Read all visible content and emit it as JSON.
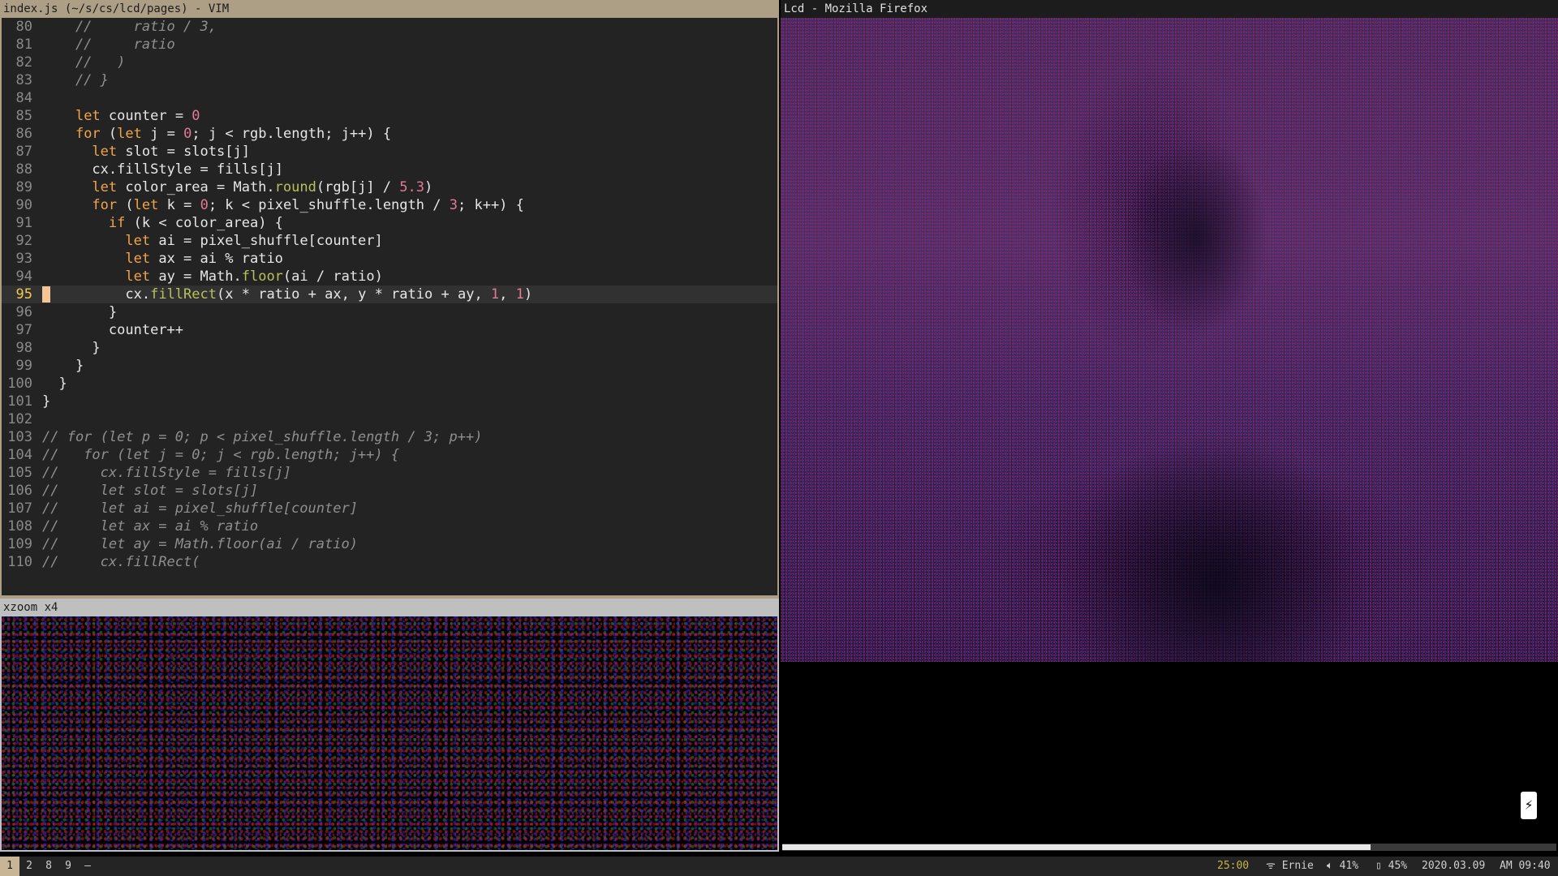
{
  "vim": {
    "title": "index.js (~/s/cs/lcd/pages) - VIM",
    "lines": [
      {
        "n": "80",
        "code": "    //     ratio / 3,",
        "kind": "comment"
      },
      {
        "n": "81",
        "code": "    //     ratio",
        "kind": "comment"
      },
      {
        "n": "82",
        "code": "    //   )",
        "kind": "comment"
      },
      {
        "n": "83",
        "code": "    // }",
        "kind": "comment"
      },
      {
        "n": "84",
        "code": "",
        "kind": "code"
      },
      {
        "n": "85",
        "code": "    let counter = 0",
        "kind": "code"
      },
      {
        "n": "86",
        "code": "    for (let j = 0; j < rgb.length; j++) {",
        "kind": "code"
      },
      {
        "n": "87",
        "code": "      let slot = slots[j]",
        "kind": "code"
      },
      {
        "n": "88",
        "code": "      cx.fillStyle = fills[j]",
        "kind": "code"
      },
      {
        "n": "89",
        "code": "      let color_area = Math.round(rgb[j] / 5.3)",
        "kind": "code"
      },
      {
        "n": "90",
        "code": "      for (let k = 0; k < pixel_shuffle.length / 3; k++) {",
        "kind": "code"
      },
      {
        "n": "91",
        "code": "        if (k < color_area) {",
        "kind": "code"
      },
      {
        "n": "92",
        "code": "          let ai = pixel_shuffle[counter]",
        "kind": "code"
      },
      {
        "n": "93",
        "code": "          let ax = ai % ratio",
        "kind": "code"
      },
      {
        "n": "94",
        "code": "          let ay = Math.floor(ai / ratio)",
        "kind": "code"
      },
      {
        "n": "95",
        "code": "          cx.fillRect(x * ratio + ax, y * ratio + ay, 1, 1)",
        "kind": "code",
        "current": true
      },
      {
        "n": "96",
        "code": "        }",
        "kind": "code"
      },
      {
        "n": "97",
        "code": "        counter++",
        "kind": "code"
      },
      {
        "n": "98",
        "code": "      }",
        "kind": "code"
      },
      {
        "n": "99",
        "code": "    }",
        "kind": "code"
      },
      {
        "n": "100",
        "code": "  }",
        "kind": "code"
      },
      {
        "n": "101",
        "code": "}",
        "kind": "code"
      },
      {
        "n": "102",
        "code": "",
        "kind": "code"
      },
      {
        "n": "103",
        "code": "// for (let p = 0; p < pixel_shuffle.length / 3; p++)",
        "kind": "comment"
      },
      {
        "n": "104",
        "code": "//   for (let j = 0; j < rgb.length; j++) {",
        "kind": "comment"
      },
      {
        "n": "105",
        "code": "//     cx.fillStyle = fills[j]",
        "kind": "comment"
      },
      {
        "n": "106",
        "code": "//     let slot = slots[j]",
        "kind": "comment"
      },
      {
        "n": "107",
        "code": "//     let ai = pixel_shuffle[counter]",
        "kind": "comment"
      },
      {
        "n": "108",
        "code": "//     let ax = ai % ratio",
        "kind": "comment"
      },
      {
        "n": "109",
        "code": "//     let ay = Math.floor(ai / ratio)",
        "kind": "comment"
      },
      {
        "n": "110",
        "code": "//     cx.fillRect(",
        "kind": "comment"
      }
    ]
  },
  "xzoom": {
    "title": "xzoom x4"
  },
  "firefox": {
    "title": "Lcd - Mozilla Firefox",
    "bolt_icon": "lightning-icon"
  },
  "statusbar": {
    "workspaces": [
      {
        "label": "1",
        "active": true
      },
      {
        "label": "2",
        "active": false
      },
      {
        "label": "8",
        "active": false
      },
      {
        "label": "9",
        "active": false
      }
    ],
    "separator": "—",
    "timer": "25:00",
    "wifi": "Ernie",
    "volume": "41%",
    "battery": "45%",
    "date": "2020.03.09",
    "time": "AM 09:40",
    "timer_color": "#c7b443"
  }
}
